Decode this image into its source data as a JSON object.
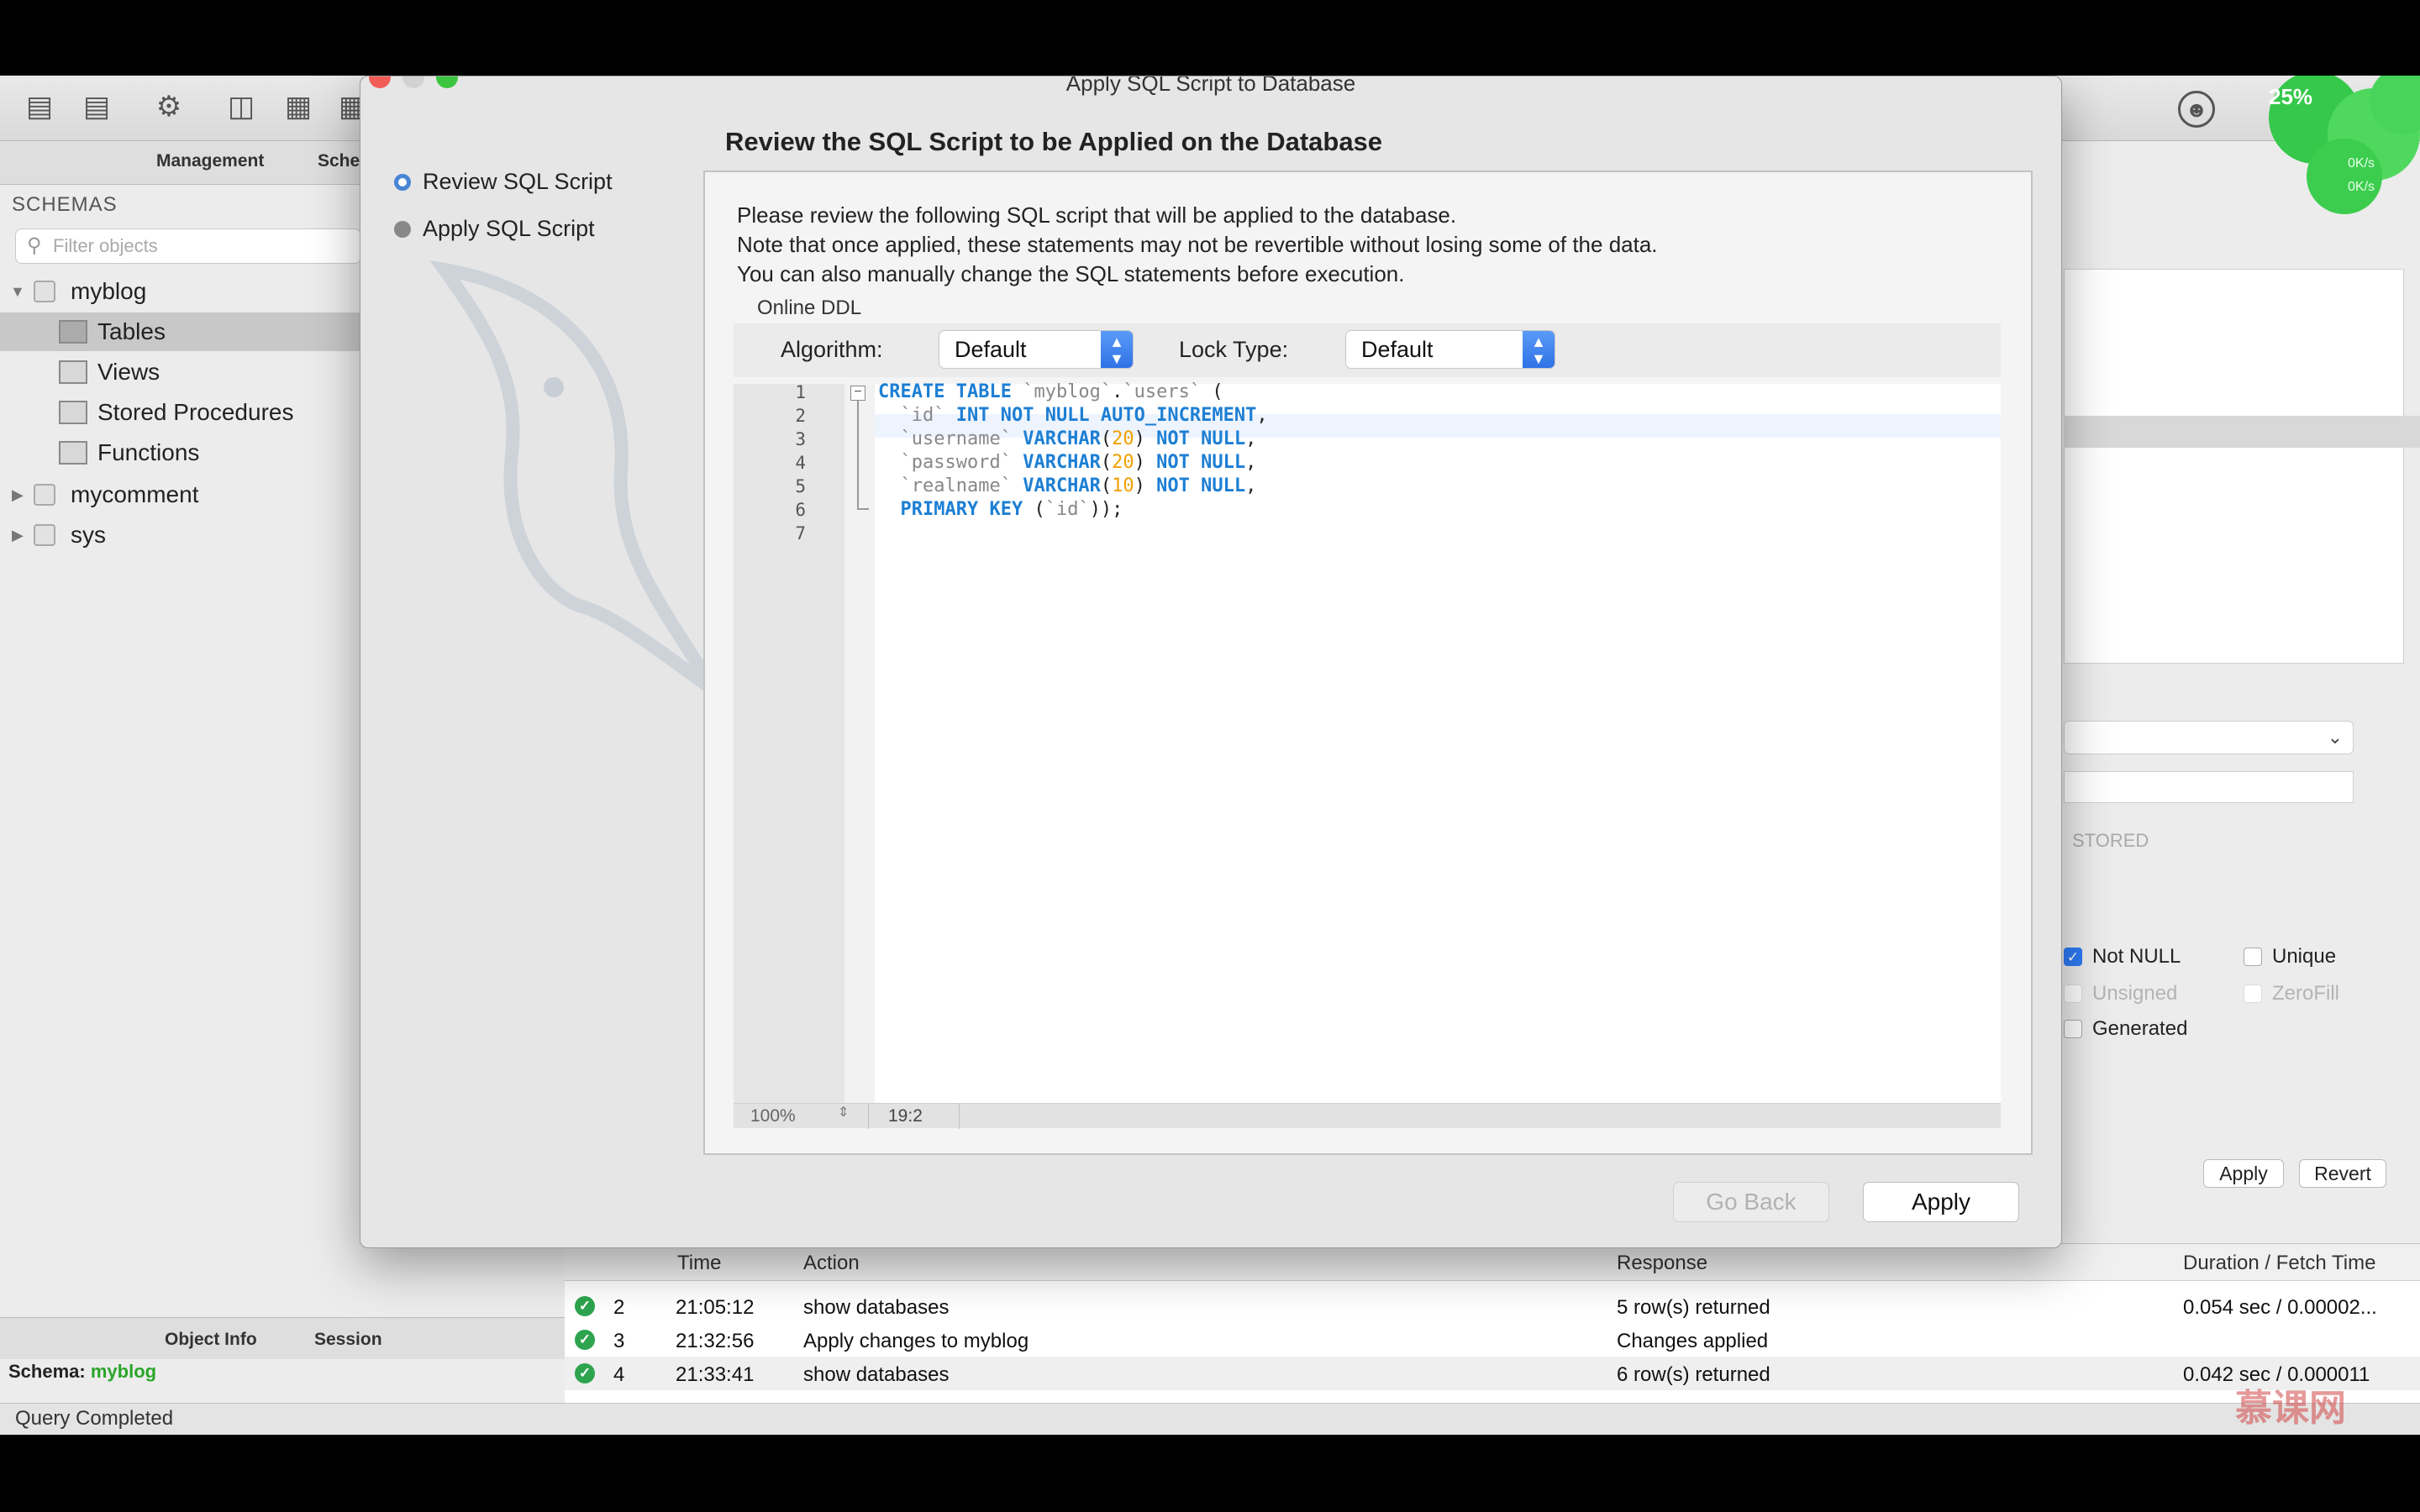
{
  "window": {
    "title": "Apply SQL Script to Database"
  },
  "left_panel": {
    "tabs": [
      "Management",
      "Sche"
    ],
    "schemas_title": "SCHEMAS",
    "filter_placeholder": "Filter objects",
    "tree": [
      {
        "label": "myblog",
        "expanded": true
      },
      {
        "label": "Tables",
        "selected": true
      },
      {
        "label": "Views"
      },
      {
        "label": "Stored Procedures"
      },
      {
        "label": "Functions"
      },
      {
        "label": "mycomment",
        "expanded": false
      },
      {
        "label": "sys",
        "expanded": false
      }
    ],
    "bottom_tabs": [
      "Object Info",
      "Session"
    ],
    "schema_label": "Schema:",
    "schema_value": "myblog"
  },
  "wizard": {
    "steps": [
      "Review SQL Script",
      "Apply SQL Script"
    ],
    "heading": "Review the SQL Script to be Applied on the Database",
    "description": [
      "Please review the following SQL script that will be applied to the database.",
      "Note that once applied, these statements may not be revertible without losing some of the data.",
      "You can also manually change the SQL statements before execution."
    ],
    "online_ddl_label": "Online DDL",
    "algorithm_label": "Algorithm:",
    "algorithm_value": "Default",
    "lock_type_label": "Lock Type:",
    "lock_type_value": "Default",
    "line_numbers": [
      "1",
      "2",
      "3",
      "4",
      "5",
      "6",
      "7"
    ],
    "zoom": "100%",
    "cursor_position": "19:2",
    "go_back_label": "Go Back",
    "apply_label": "Apply"
  },
  "right_panel": {
    "stored_label": "STORED",
    "checkboxes": [
      {
        "label": "Not NULL",
        "checked": true,
        "enabled": true
      },
      {
        "label": "Unique",
        "checked": false,
        "enabled": true
      },
      {
        "label": "Unsigned",
        "checked": false,
        "enabled": false
      },
      {
        "label": "ZeroFill",
        "checked": false,
        "enabled": false
      },
      {
        "label": "Generated",
        "checked": false,
        "enabled": true
      }
    ],
    "apply_label": "Apply",
    "revert_label": "Revert"
  },
  "badge": {
    "percent": "25%",
    "line1": "0K/s",
    "line2": "0K/s"
  },
  "output": {
    "columns": [
      "Time",
      "Action",
      "Response",
      "Duration / Fetch Time"
    ],
    "rows": [
      {
        "num": "2",
        "time": "21:05:12",
        "action": "show databases",
        "response": "5 row(s) returned",
        "duration": "0.054 sec / 0.00002..."
      },
      {
        "num": "3",
        "time": "21:32:56",
        "action": "Apply changes to myblog",
        "response": "Changes applied",
        "duration": ""
      },
      {
        "num": "4",
        "time": "21:33:41",
        "action": "show databases",
        "response": "6 row(s) returned",
        "duration": "0.042 sec / 0.000011"
      }
    ]
  },
  "status_bar": "Query Completed",
  "watermark": "慕课网",
  "colors": {
    "accent": "#2e7bf6",
    "keyword": "#1d7fd4",
    "ok": "#2ea44f",
    "schema_value": "#2aa52a"
  }
}
